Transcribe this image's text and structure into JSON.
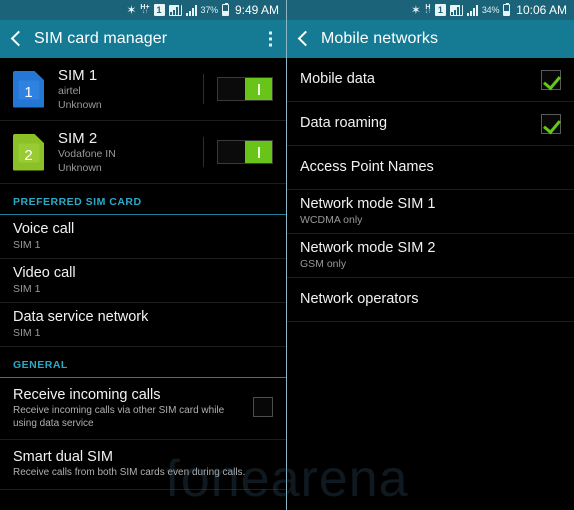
{
  "left": {
    "statusbar": {
      "bluetooth_icon": "bluetooth-icon",
      "hspa_label": "H+",
      "hspa_sub": "↓↑",
      "sim_indicator": "1",
      "signal1_icon": "signal-bars-boxed-icon",
      "signal2_icon": "signal-bars-icon",
      "battery_pct": "37%",
      "battery_icon": "battery-icon",
      "time": "9:49 AM"
    },
    "actionbar": {
      "back_icon": "back-chevron-icon",
      "title": "SIM card manager",
      "overflow_icon": "overflow-menu-icon"
    },
    "sims": [
      {
        "icon": "sim-card-1-icon",
        "number": "1",
        "name": "SIM 1",
        "carrier": "airtel",
        "status": "Unknown",
        "toggle_state": "on"
      },
      {
        "icon": "sim-card-2-icon",
        "number": "2",
        "name": "SIM 2",
        "carrier": "Vodafone IN",
        "status": "Unknown",
        "toggle_state": "on"
      }
    ],
    "preferred_section": {
      "header": "PREFERRED SIM CARD",
      "items": [
        {
          "title": "Voice call",
          "sub": "SIM 1"
        },
        {
          "title": "Video call",
          "sub": "SIM 1"
        },
        {
          "title": "Data service network",
          "sub": "SIM 1"
        }
      ]
    },
    "general_section": {
      "header": "GENERAL",
      "items": [
        {
          "title": "Receive incoming calls",
          "sub": "Receive incoming calls via other SIM card while using data service",
          "checkbox": "unchecked"
        },
        {
          "title": "Smart dual SIM",
          "sub": "Receive calls from both SIM cards even during calls.",
          "checkbox": "none"
        }
      ]
    }
  },
  "right": {
    "statusbar": {
      "bluetooth_icon": "bluetooth-icon",
      "hspa_label": "H",
      "hspa_sub": "↓↑",
      "sim_indicator": "1",
      "signal1_icon": "signal-bars-boxed-icon",
      "signal2_icon": "signal-bars-icon",
      "battery_pct": "34%",
      "battery_icon": "battery-icon",
      "time": "10:06 AM"
    },
    "actionbar": {
      "back_icon": "back-chevron-icon",
      "title": "Mobile networks"
    },
    "items": [
      {
        "title": "Mobile data",
        "sub": "",
        "checkbox": "checked"
      },
      {
        "title": "Data roaming",
        "sub": "",
        "checkbox": "checked"
      },
      {
        "title": "Access Point Names",
        "sub": "",
        "checkbox": "none"
      },
      {
        "title": "Network mode SIM 1",
        "sub": "WCDMA only",
        "checkbox": "none"
      },
      {
        "title": "Network mode SIM 2",
        "sub": "GSM only",
        "checkbox": "none"
      },
      {
        "title": "Network operators",
        "sub": "",
        "checkbox": "none"
      }
    ]
  },
  "watermark": {
    "text": "fonearena"
  },
  "colors": {
    "statusbar_bg": "#1a6378",
    "actionbar_bg": "#157a94",
    "section_header": "#2aa9c7",
    "toggle_on": "#69c41a",
    "checkbox_check": "#64c819",
    "sim1": "#2477d4",
    "sim2": "#8cc027"
  }
}
